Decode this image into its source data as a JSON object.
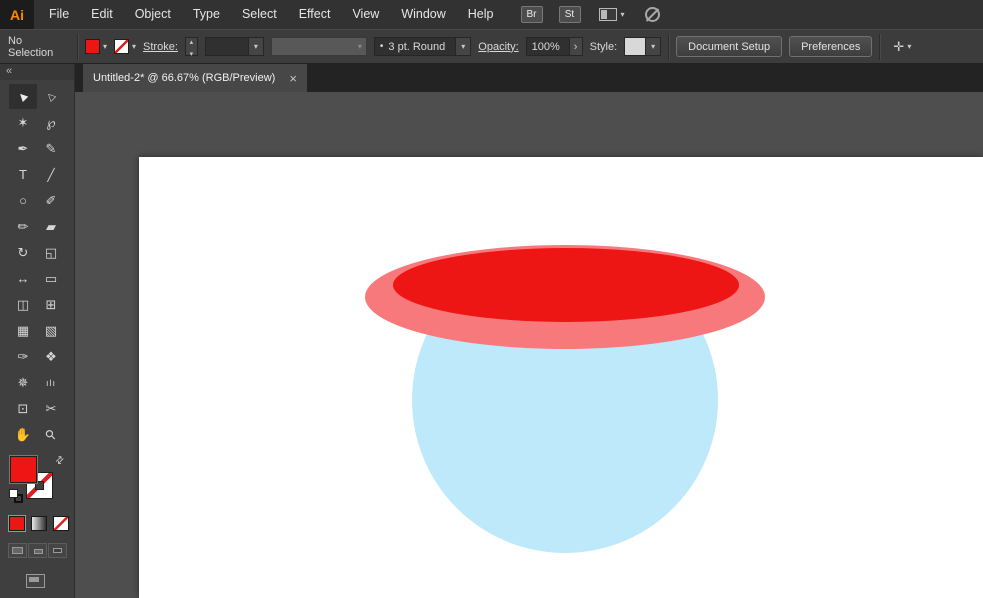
{
  "app": {
    "logo_text": "Ai",
    "menus": [
      "File",
      "Edit",
      "Object",
      "Type",
      "Select",
      "Effect",
      "View",
      "Window",
      "Help"
    ],
    "bridge_button": "Br",
    "stock_button": "St"
  },
  "control_bar": {
    "selection_status": "No Selection",
    "stroke_label": "Stroke:",
    "brush_preview_glyph": "•",
    "brush_value": "3 pt. Round",
    "opacity_label": "Opacity:",
    "opacity_value": "100%",
    "opacity_more_glyph": "›",
    "style_label": "Style:",
    "buttons": {
      "document_setup": "Document Setup",
      "preferences": "Preferences"
    }
  },
  "document_tab": {
    "title": "Untitled-2* @ 66.67% (RGB/Preview)",
    "close_glyph": "×"
  },
  "tools_panel": {
    "collapse_glyph": "«",
    "active_tool": "selection-tool",
    "tools": [
      {
        "name": "selection-tool",
        "glyph": "▶"
      },
      {
        "name": "direct-selection-tool",
        "glyph": "▷"
      },
      {
        "name": "magic-wand-tool",
        "glyph": "✶"
      },
      {
        "name": "lasso-tool",
        "glyph": "℘"
      },
      {
        "name": "pen-tool",
        "glyph": "✒"
      },
      {
        "name": "curvature-tool",
        "glyph": "✎"
      },
      {
        "name": "type-tool",
        "glyph": "T"
      },
      {
        "name": "line-segment-tool",
        "glyph": "╱"
      },
      {
        "name": "ellipse-tool",
        "glyph": "○"
      },
      {
        "name": "paintbrush-tool",
        "glyph": "✐"
      },
      {
        "name": "pencil-tool",
        "glyph": "✏"
      },
      {
        "name": "eraser-tool",
        "glyph": "▰"
      },
      {
        "name": "rotate-tool",
        "glyph": "↻"
      },
      {
        "name": "scale-tool",
        "glyph": "◱"
      },
      {
        "name": "width-tool",
        "glyph": "↔"
      },
      {
        "name": "free-transform-tool",
        "glyph": "▭"
      },
      {
        "name": "shape-builder-tool",
        "glyph": "◫"
      },
      {
        "name": "perspective-grid-tool",
        "glyph": "⊞"
      },
      {
        "name": "mesh-tool",
        "glyph": "▦"
      },
      {
        "name": "gradient-tool",
        "glyph": "▧"
      },
      {
        "name": "eyedropper-tool",
        "glyph": "✑"
      },
      {
        "name": "blend-tool",
        "glyph": "❖"
      },
      {
        "name": "symbol-sprayer-tool",
        "glyph": "✵"
      },
      {
        "name": "column-graph-tool",
        "glyph": "ılı"
      },
      {
        "name": "artboard-tool",
        "glyph": "⊡"
      },
      {
        "name": "slice-tool",
        "glyph": "✂"
      },
      {
        "name": "hand-tool",
        "glyph": "✋"
      },
      {
        "name": "zoom-tool",
        "glyph": "⚲"
      }
    ]
  },
  "swatches": {
    "fill_color": "#EE1515",
    "stroke": "none"
  },
  "artwork": {
    "blue_circle_color": "#BEE9FA",
    "salmon_ellipse_color": "#F8797C",
    "red_ellipse_color": "#EE1515"
  }
}
